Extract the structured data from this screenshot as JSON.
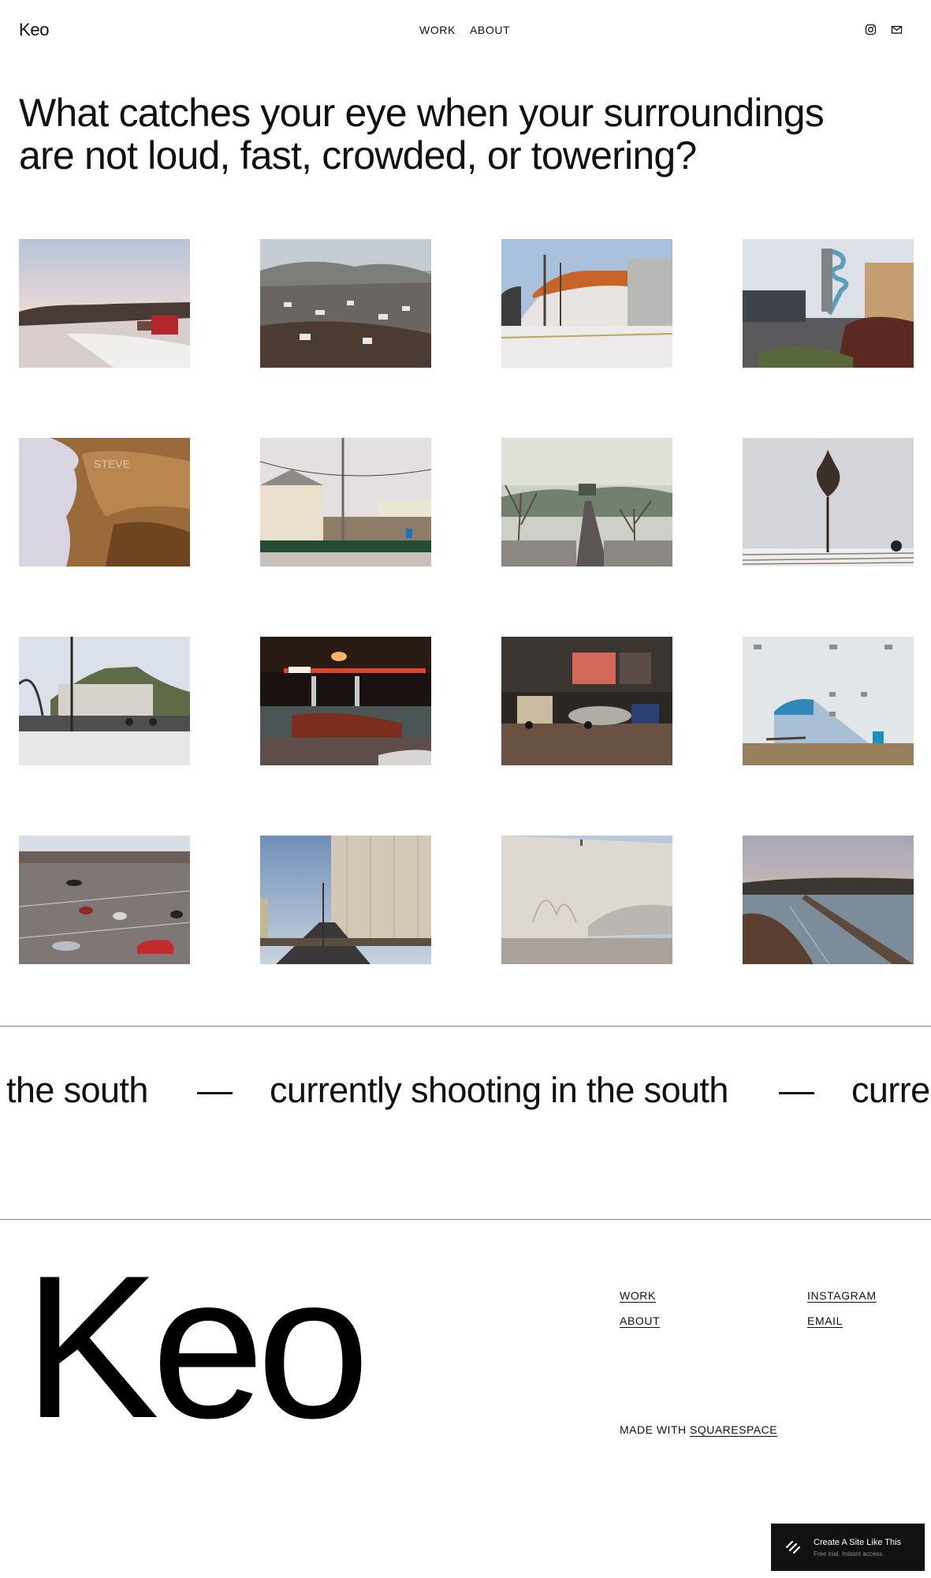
{
  "header": {
    "logo": "Keo",
    "nav": [
      {
        "label": "WORK"
      },
      {
        "label": "ABOUT"
      }
    ],
    "social_icons": [
      "instagram-icon",
      "email-icon"
    ]
  },
  "hero": {
    "headline": "What catches your eye when your surroundings are not loud, fast, crowded, or towering?"
  },
  "gallery": {
    "photos": [
      {
        "subject": "snowy riverbank with red house"
      },
      {
        "subject": "river valley town in winter"
      },
      {
        "subject": "quonset hut with orange roof and silo"
      },
      {
        "subject": "water slide tower behind building"
      },
      {
        "subject": "carved sandstone rock face"
      },
      {
        "subject": "houses behind fence with power lines"
      },
      {
        "subject": "street leading to hilltop building"
      },
      {
        "subject": "lone bare tree in snowy field"
      },
      {
        "subject": "bluff over parking lot"
      },
      {
        "subject": "gas station at night"
      },
      {
        "subject": "vintage cars in hangar"
      },
      {
        "subject": "white wall with blue awning"
      },
      {
        "subject": "parking lot with red car"
      },
      {
        "subject": "grain elevator by road"
      },
      {
        "subject": "blank wall with tree shadow"
      },
      {
        "subject": "railroad bridge over river"
      }
    ]
  },
  "marquee": {
    "items": [
      "the south",
      "—",
      "currently shooting in the south",
      "—",
      "curre"
    ]
  },
  "footer": {
    "big_logo": "Keo",
    "links": [
      {
        "label": "WORK"
      },
      {
        "label": "ABOUT"
      },
      {
        "label": "INSTAGRAM"
      },
      {
        "label": "EMAIL"
      }
    ],
    "made_with": "MADE WITH",
    "platform": "SQUARESPACE"
  },
  "badge": {
    "title": "Create A Site Like This",
    "subtitle": "Free trial. Instant access.",
    "icon": "squarespace-logo-icon"
  },
  "colors": {
    "text": "#111111",
    "background": "#ffffff",
    "badge_background": "#111111",
    "divider": "#8a8a8a"
  }
}
